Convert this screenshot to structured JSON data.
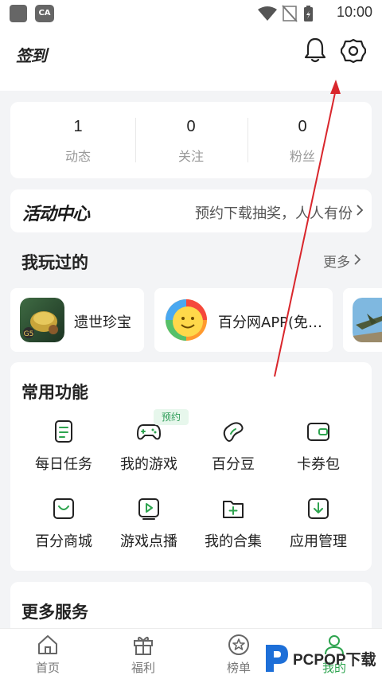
{
  "status_bar": {
    "time": "10:00",
    "badge": "CA"
  },
  "header": {
    "signin_label": "签到"
  },
  "stats": [
    {
      "value": "1",
      "label": "动态"
    },
    {
      "value": "0",
      "label": "关注"
    },
    {
      "value": "0",
      "label": "粉丝"
    }
  ],
  "activity": {
    "title": "活动中心",
    "description": "预约下载抽奖，人人有份"
  },
  "played": {
    "title": "我玩过的",
    "more_label": "更多",
    "games": [
      {
        "name": "遗世珍宝"
      },
      {
        "name": "百分网APP(免…"
      },
      {
        "name": ""
      }
    ]
  },
  "functions": {
    "title": "常用功能",
    "badge": "预约",
    "items": [
      {
        "label": "每日任务",
        "icon": "task-icon"
      },
      {
        "label": "我的游戏",
        "icon": "gamepad-icon"
      },
      {
        "label": "百分豆",
        "icon": "bean-icon"
      },
      {
        "label": "卡券包",
        "icon": "wallet-icon"
      },
      {
        "label": "百分商城",
        "icon": "shop-icon"
      },
      {
        "label": "游戏点播",
        "icon": "play-icon"
      },
      {
        "label": "我的合集",
        "icon": "folder-add-icon"
      },
      {
        "label": "应用管理",
        "icon": "download-icon"
      }
    ]
  },
  "services": {
    "title": "更多服务"
  },
  "bottom_nav": [
    {
      "label": "首页",
      "icon": "home-icon"
    },
    {
      "label": "福利",
      "icon": "gift-icon"
    },
    {
      "label": "榜单",
      "icon": "star-badge-icon"
    },
    {
      "label": "我的",
      "icon": "profile-icon",
      "active": true
    }
  ],
  "watermark": {
    "text": "PCPOP下载"
  },
  "colors": {
    "accent": "#2ea44f",
    "annotation_arrow": "#d9262c",
    "background": "#f3f4f6"
  }
}
